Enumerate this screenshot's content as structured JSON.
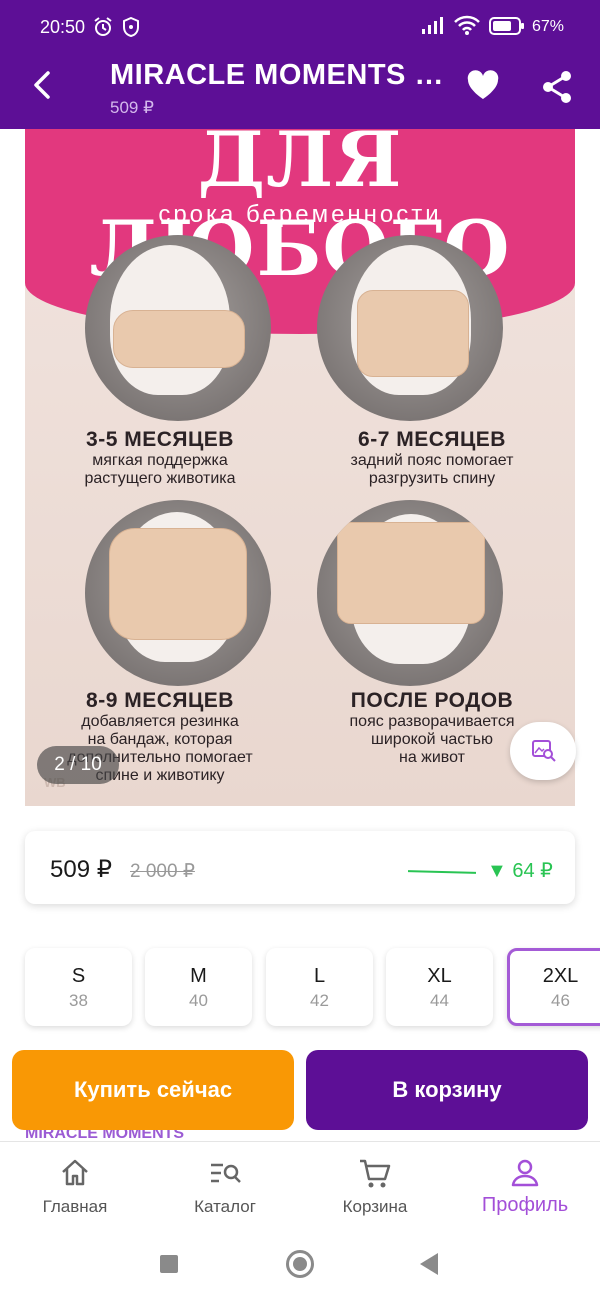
{
  "status_bar": {
    "time": "20:50",
    "battery": "67%",
    "icons": [
      "alarm-icon",
      "shield-icon",
      "signal-icon",
      "wifi-icon",
      "battery-icon"
    ]
  },
  "header": {
    "title": "MIRACLE MOMENTS •…",
    "price": "509 ₽",
    "icons": [
      "back-arrow-icon",
      "heart-icon",
      "share-icon"
    ]
  },
  "gallery": {
    "headline": "ДЛЯ ЛЮБОГО",
    "subheadline": "срока беременности",
    "panels": [
      {
        "title": "3-5 МЕСЯЦЕВ",
        "lines": [
          "мягкая поддержка",
          "растущего животика"
        ]
      },
      {
        "title": "6-7 МЕСЯЦЕВ",
        "lines": [
          "задний пояс помогает",
          "разгрузить спину"
        ]
      },
      {
        "title": "8-9 МЕСЯЦЕВ",
        "lines": [
          "добавляется резинка",
          "на бандаж, которая",
          "дополнительно помогает",
          "спине и животику"
        ]
      },
      {
        "title": "ПОСЛЕ РОДОВ",
        "lines": [
          "пояс разворачивается",
          "широкой частью",
          "на живот"
        ]
      }
    ],
    "watermark": "WB",
    "counter": "2 / 10"
  },
  "price_card": {
    "current": "509 ₽",
    "old": "2 000 ₽",
    "change": "▼ 64 ₽",
    "change_color": "#29c453"
  },
  "sizes": [
    {
      "label": "S",
      "ru": "38",
      "selected": false
    },
    {
      "label": "M",
      "ru": "40",
      "selected": false
    },
    {
      "label": "L",
      "ru": "42",
      "selected": false
    },
    {
      "label": "XL",
      "ru": "44",
      "selected": false
    },
    {
      "label": "2XL",
      "ru": "46",
      "selected": true
    }
  ],
  "actions": {
    "buy_now": "Купить сейчас",
    "add_to_cart": "В корзину"
  },
  "brand_peek": "MIRACLE MOMENTS",
  "bottom_nav": [
    {
      "label": "Главная",
      "icon": "home-icon",
      "active": false
    },
    {
      "label": "Каталог",
      "icon": "catalog-icon",
      "active": false
    },
    {
      "label": "Корзина",
      "icon": "cart-icon",
      "active": false
    },
    {
      "label": "Профиль",
      "icon": "profile-icon",
      "active": true
    }
  ],
  "colors": {
    "brand_purple": "#5d0f96",
    "accent_orange": "#f99805",
    "accent_pink": "#e2387e",
    "active_nav": "#a34fd8"
  }
}
